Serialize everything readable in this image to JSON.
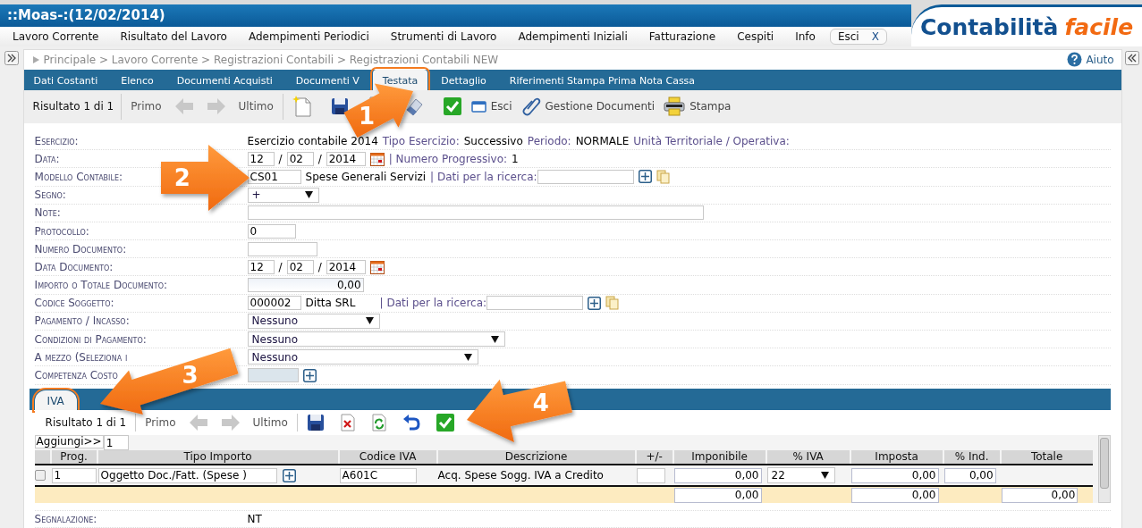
{
  "app": {
    "title": "::Moas-:(12/02/2014)",
    "logo_main": "Contabilità",
    "logo_accent": "facile"
  },
  "menu": [
    {
      "label": "Lavoro Corrente"
    },
    {
      "label": "Risultato del Lavoro"
    },
    {
      "label": "Adempimenti Periodici"
    },
    {
      "label": "Strumenti di Lavoro"
    },
    {
      "label": "Adempimenti Iniziali"
    },
    {
      "label": "Fatturazione"
    },
    {
      "label": "Cespiti"
    },
    {
      "label": "Info"
    }
  ],
  "exit_button": {
    "label": "Esci",
    "close": "X"
  },
  "breadcrumb": "Principale > Lavoro Corrente > Registrazioni Contabili > Registrazioni Contabili NEW",
  "help": "Aiuto",
  "tabs": [
    {
      "label": "Dati Costanti",
      "selected": false,
      "highlighted": false
    },
    {
      "label": "Elenco",
      "selected": false,
      "highlighted": false
    },
    {
      "label": "Documenti Acquisti",
      "selected": false,
      "highlighted": false
    },
    {
      "label": "Documenti V",
      "selected": false,
      "highlighted": false
    },
    {
      "label": "Testata",
      "selected": true,
      "highlighted": true
    },
    {
      "label": "Dettaglio",
      "selected": false,
      "highlighted": false
    },
    {
      "label": "Riferimenti Stampa Prima Nota Cassa",
      "selected": false,
      "highlighted": false
    }
  ],
  "toolbar": {
    "result": "Risultato 1 di 1",
    "first": "Primo",
    "last": "Ultimo",
    "nav_disabled": true,
    "actions": [
      {
        "label": "Esci"
      },
      {
        "label": "Gestione Documenti"
      },
      {
        "label": "Stampa"
      }
    ]
  },
  "form": [
    {
      "kind": "info",
      "label": "Esercizio:",
      "parts": [
        {
          "text": "Esercizio contabile 2014",
          "kind": "value"
        },
        {
          "text": "Tipo Esercizio:",
          "kind": "caption"
        },
        {
          "text": "Successivo",
          "kind": "value"
        },
        {
          "text": "Periodo:",
          "kind": "caption"
        },
        {
          "text": "NORMALE",
          "kind": "value"
        },
        {
          "text": "Unità Territoriale / Operativa:",
          "kind": "caption"
        }
      ]
    },
    {
      "kind": "date",
      "label": "Data:",
      "day": "12",
      "month": "02",
      "year": "2014",
      "separator": "/",
      "extra": [
        {
          "text": "| Numero Progressivo:",
          "kind": "caption"
        },
        {
          "text": "1",
          "kind": "value"
        }
      ]
    },
    {
      "kind": "lookup",
      "label": "Modello Contabile:",
      "code": "CS01",
      "name": "Spese Generali Servizi",
      "search_label": "| Dati per la ricerca:"
    },
    {
      "kind": "select",
      "label": "Segno:",
      "value": "+"
    },
    {
      "kind": "text",
      "label": "Note:"
    },
    {
      "kind": "text",
      "label": "Protocollo:",
      "value": "0"
    },
    {
      "kind": "text",
      "label": "Numero Documento:"
    },
    {
      "kind": "date",
      "label": "Data Documento:",
      "day": "12",
      "month": "02",
      "year": "2014",
      "separator": "/"
    },
    {
      "kind": "amount",
      "label": "Importo o Totale Documento:",
      "value": "0,00"
    },
    {
      "kind": "lookup",
      "label": "Codice Soggetto:",
      "code": "000002",
      "name": "Ditta SRL",
      "search_label": "| Dati per la ricerca:"
    },
    {
      "kind": "select",
      "label": "Pagamento / Incasso:",
      "value": "Nessuno"
    },
    {
      "kind": "select",
      "label": "Condizioni di Pagamento:",
      "value": "Nessuno"
    },
    {
      "kind": "select",
      "label": "A mezzo (Seleziona i",
      "value": "Nessuno"
    },
    {
      "kind": "picker",
      "label": "Competenza Costo",
      "disabled": true
    }
  ],
  "sub_tabs": [
    {
      "label": "IVA",
      "selected": true,
      "highlighted": true
    }
  ],
  "sub_toolbar": {
    "result": "Risultato 1 di 1",
    "first": "Primo",
    "last": "Ultimo",
    "nav_disabled": true
  },
  "add_row": {
    "label": "Aggiungi>>",
    "value": "1"
  },
  "table": {
    "columns": [
      "Prog.",
      "Tipo Importo",
      "Codice IVA",
      "Descrizione",
      "+/-",
      "Imponibile",
      "% IVA",
      "Imposta",
      "% Ind.",
      "Totale"
    ],
    "rows": [
      {
        "checked": false,
        "prog": "1",
        "tipo_importo": "Oggetto Doc./Fatt. (Spese )",
        "codice_iva": "A601C",
        "descrizione": "Acq. Spese Sogg. IVA a Credito",
        "imponibile": "0,00",
        "iva": "22",
        "imposta": "0,00",
        "ind": "0,00"
      }
    ],
    "totals": {
      "imponibile": "0,00",
      "imposta": "0,00",
      "totale": "0,00"
    }
  },
  "footer_row": {
    "label": "Segnalazione:",
    "value": "NT"
  },
  "callouts": [
    {
      "number": "1"
    },
    {
      "number": "2"
    },
    {
      "number": "3"
    },
    {
      "number": "4"
    }
  ]
}
